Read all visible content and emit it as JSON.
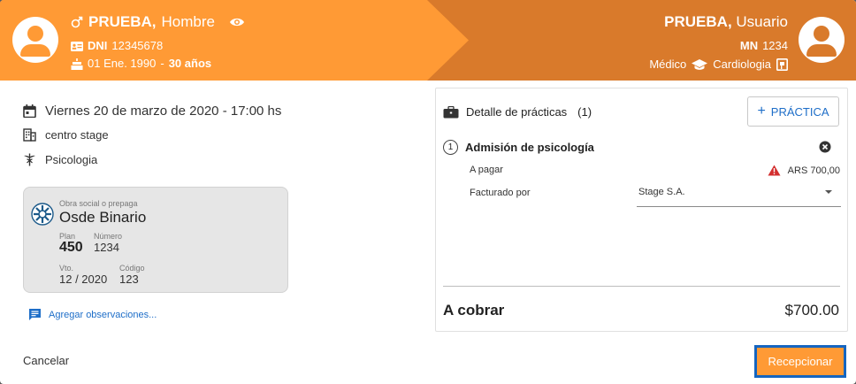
{
  "patient": {
    "name": "PRUEBA,",
    "gender": "Hombre",
    "dni_label": "DNI",
    "dni": "12345678",
    "birth_date": "01 Ene. 1990",
    "age": "30 años"
  },
  "doctor": {
    "name": "PRUEBA,",
    "role": "Usuario",
    "mn_label": "MN",
    "mn": "1234",
    "profession": "Médico",
    "specialty": "Cardiologia"
  },
  "appointment": {
    "datetime": "Viernes 20 de marzo de 2020 - 17:00 hs",
    "location": "centro stage",
    "service": "Psicologia"
  },
  "insurance": {
    "caption": "Obra social o prepaga",
    "name": "Osde Binario",
    "plan_label": "Plan",
    "plan": "450",
    "number_label": "Número",
    "number": "1234",
    "expiry_label": "Vto.",
    "expiry": "12 / 2020",
    "code_label": "Código",
    "code": "123"
  },
  "observations_link": "Agregar observaciones...",
  "practices": {
    "title": "Detalle de prácticas",
    "count": "(1)",
    "add_button": "PRÁCTICA",
    "item_number": "1",
    "item_name": "Admisión de psicología",
    "to_pay_label": "A pagar",
    "to_pay_value": "ARS 700,00",
    "billed_by_label": "Facturado por",
    "billed_by_value": "Stage S.A.",
    "total_label": "A cobrar",
    "total_value": "$700.00"
  },
  "actions": {
    "cancel": "Cancelar",
    "receive": "Recepcionar"
  },
  "colors": {
    "header_left": "#ff9a35",
    "header_right": "#d97a2b",
    "link_blue": "#1e6ec8",
    "focus_border": "#1565c0",
    "warning_red": "#d32f2f"
  },
  "icons": [
    "male-icon",
    "eye-icon",
    "id-card-icon",
    "cake-icon",
    "school-icon",
    "badge-icon",
    "calendar-icon",
    "building-icon",
    "caduceus-icon",
    "insurance-logo-icon",
    "comment-icon",
    "briefcase-icon",
    "plus-icon",
    "close-circle-icon",
    "warning-icon",
    "chevron-down-icon"
  ]
}
